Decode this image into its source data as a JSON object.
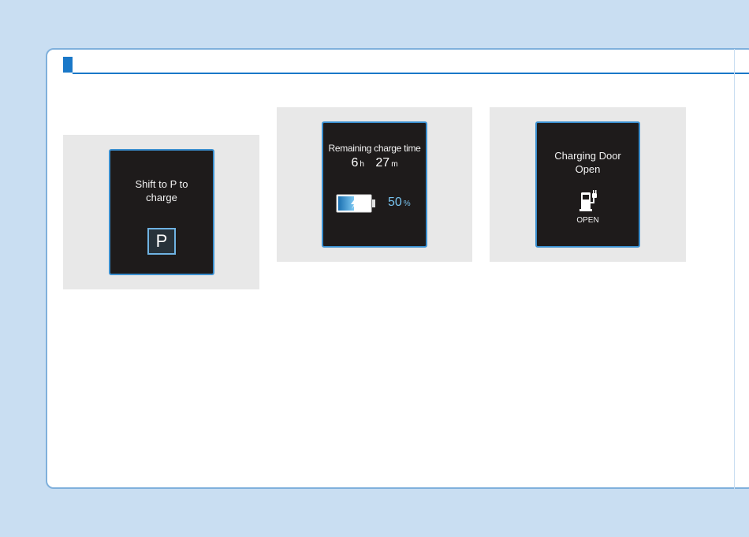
{
  "panels": [
    {
      "message": [
        "Shift to P to",
        "charge"
      ],
      "gear": "P"
    },
    {
      "title": "Remaining charge time",
      "hours": "6",
      "hours_unit": "h",
      "minutes": "27",
      "minutes_unit": "m",
      "battery_level": 50,
      "percent": "50",
      "percent_unit": "%",
      "battery_icon": "battery-charging-icon"
    },
    {
      "message": [
        "Charging Door",
        "Open"
      ],
      "icon": "fuel-plug-icon",
      "status": "OPEN"
    }
  ],
  "colors": {
    "page_background": "#c9def2",
    "accent": "#1a78c8",
    "screen_border": "#3a8fcf",
    "percent_text": "#78c3ef"
  }
}
